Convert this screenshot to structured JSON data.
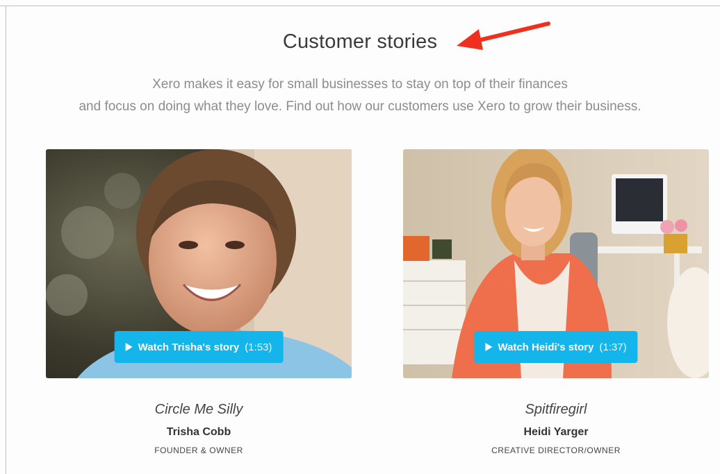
{
  "section": {
    "title": "Customer stories",
    "subtitle_line1": "Xero makes it easy for small businesses to stay on top of their finances",
    "subtitle_line2": "and focus on doing what they love. Find out how our customers use Xero to grow their business."
  },
  "annotation": {
    "arrow_color": "#f0301e"
  },
  "stories": [
    {
      "button_label": "Watch Trisha's story",
      "duration": "(1:53)",
      "company": "Circle Me Silly",
      "name": "Trisha Cobb",
      "role": "FOUNDER & OWNER"
    },
    {
      "button_label": "Watch Heidi's story",
      "duration": "(1:37)",
      "company": "Spitfiregirl",
      "name": "Heidi Yarger",
      "role": "CREATIVE DIRECTOR/OWNER"
    }
  ],
  "colors": {
    "button": "#13b5ea",
    "heading": "#3a3a3a",
    "subtitle": "#8c8c8c"
  },
  "icons": {
    "play": "play-icon",
    "annotation": "red-arrow-icon"
  }
}
